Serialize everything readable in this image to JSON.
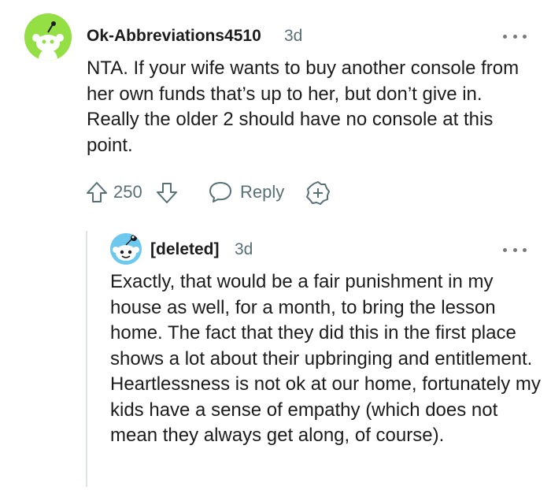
{
  "comments": {
    "top": {
      "author": "Ok-Abbreviations4510",
      "age": "3d",
      "body": "NTA. If your wife wants to buy another console from her own funds that’s up to her, but don’t give in. Really the older 2 should have no console at this point.",
      "score": "250",
      "reply_label": "Reply",
      "icons": {
        "upvote": "upvote-arrow-icon",
        "downvote": "downvote-arrow-icon",
        "reply": "speech-bubble-icon",
        "award": "plus-circle-icon",
        "more": "more-options-icon"
      }
    },
    "reply": {
      "author": "[deleted]",
      "age": "3d",
      "body": "Exactly, that would be a fair punishment in my house as well, for a month, to bring the lesson home. The fact that they did this in the first place shows a lot about their upbringing and entitlement. Heartlessness is not ok at our home, fortunately my kids have a sense of empathy (which does not mean they always get along, of course).",
      "icons": {
        "more": "more-options-icon"
      }
    }
  },
  "colors": {
    "avatar_main": "#94e044",
    "avatar_child": "#6dc8f0",
    "meta_text": "#576f76",
    "body_text": "#1c1c1c",
    "thread_line": "#dfe4e6"
  }
}
